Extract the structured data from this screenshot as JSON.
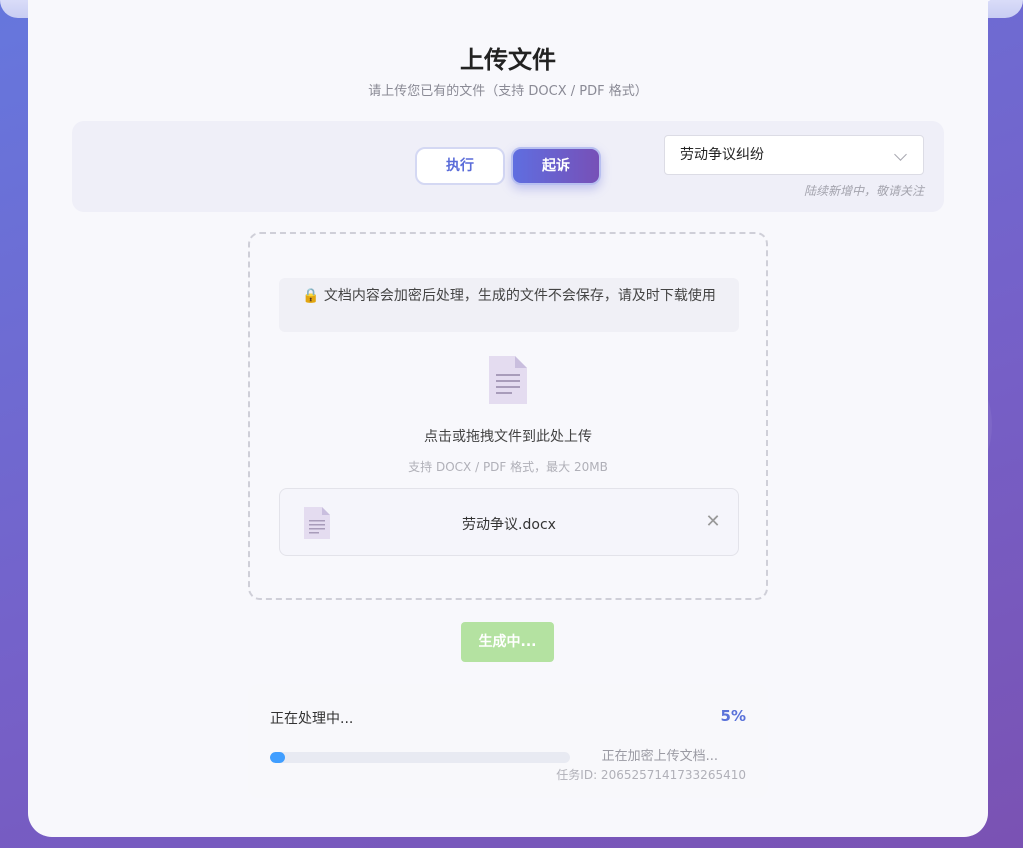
{
  "page": {
    "title": "上传文件",
    "subtitle": "请上传您已有的文件（支持 DOCX / PDF 格式）"
  },
  "mode": {
    "exec_label": "执行",
    "sue_label": "起诉",
    "active": "起诉"
  },
  "category_select": {
    "selected": "劳动争议纠纷",
    "note": "陆续新增中，敬请关注"
  },
  "upload": {
    "notice_icon": "lock-icon",
    "notice": "🔒 文档内容会加密后处理，生成的文件不会保存，请及时下载使用",
    "prompt": "点击或拖拽文件到此处上传",
    "hint": "支持 DOCX / PDF 格式，最大 20MB",
    "file_icon": "document-icon",
    "file": {
      "name": "劳动争议.docx",
      "remove_icon": "close-icon"
    }
  },
  "generate_button": {
    "label": "生成中..."
  },
  "progress": {
    "title": "正在处理中...",
    "percent_text": "5%",
    "percent": 5,
    "status": "正在加密上传文档...",
    "task_id": "任务ID: 2065257141733265410"
  },
  "colors": {
    "accent": "#5a72d9",
    "progress_bar": "#409eff",
    "generate_disabled": "#b4e2a1"
  }
}
